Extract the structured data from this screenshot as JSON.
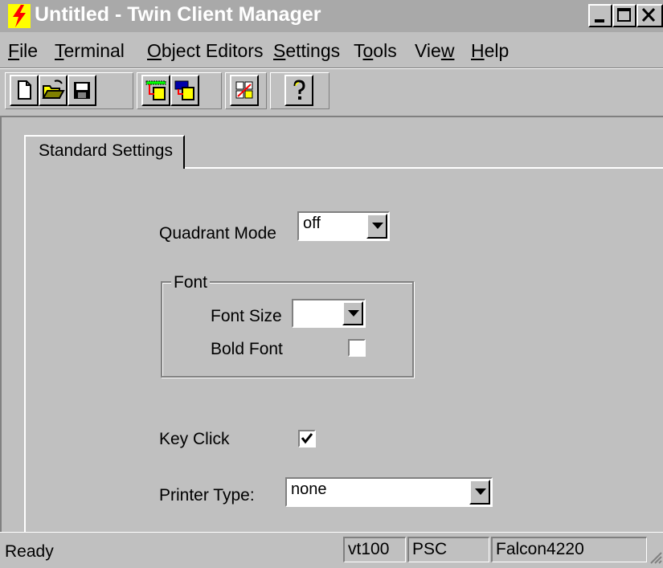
{
  "window": {
    "title": "Untitled - Twin Client Manager",
    "controls": [
      "minimize-icon",
      "maximize-icon",
      "close-icon"
    ]
  },
  "menu": {
    "items": [
      {
        "label": "File",
        "mnemonic": "F"
      },
      {
        "label": "Terminal",
        "mnemonic": "T"
      },
      {
        "label": "Object Editors",
        "mnemonic": "O"
      },
      {
        "label": "Settings",
        "mnemonic": "S"
      },
      {
        "label": "Tools",
        "mnemonic": "o"
      },
      {
        "label": "View",
        "mnemonic": "w"
      },
      {
        "label": "Help",
        "mnemonic": "H"
      }
    ]
  },
  "toolbar": {
    "buttons": [
      "new-file-icon",
      "open-folder-icon",
      "save-icon",
      "download-icon",
      "upload-icon",
      "editor-icon",
      "help-icon"
    ]
  },
  "tab": {
    "label": "Standard Settings"
  },
  "settings": {
    "quadrant_mode": {
      "label": "Quadrant Mode",
      "value": "off"
    },
    "font_group": {
      "label": "Font",
      "font_size": {
        "label": "Font Size",
        "value": ""
      },
      "bold_font": {
        "label": "Bold Font",
        "checked": false
      }
    },
    "key_click": {
      "label": "Key Click",
      "checked": true
    },
    "printer_type": {
      "label": "Printer Type:",
      "value": "none"
    }
  },
  "statusbar": {
    "ready": "Ready",
    "terminal": "vt100",
    "mode": "PSC",
    "device": "Falcon4220"
  }
}
